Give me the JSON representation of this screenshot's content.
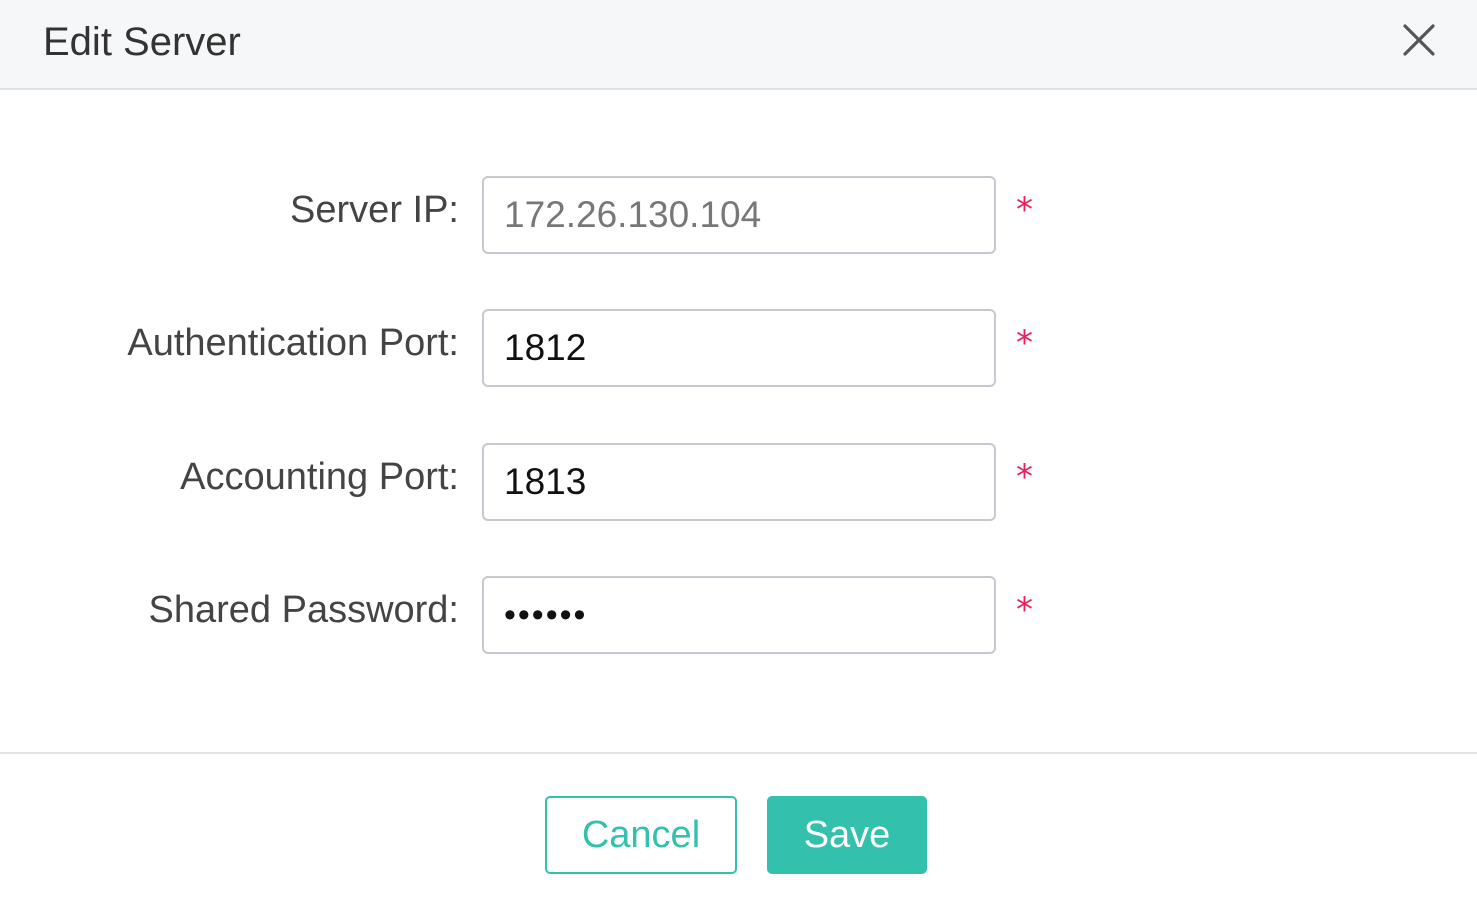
{
  "dialog": {
    "title": "Edit Server"
  },
  "form": {
    "fields": [
      {
        "label": "Server IP:",
        "value": "172.26.130.104",
        "required_mark": "*"
      },
      {
        "label": "Authentication Port:",
        "value": "1812",
        "required_mark": "*"
      },
      {
        "label": "Accounting Port:",
        "value": "1813",
        "required_mark": "*"
      },
      {
        "label": "Shared Password:",
        "value": "••••••",
        "required_mark": "*"
      }
    ]
  },
  "buttons": {
    "cancel_label": "Cancel",
    "save_label": "Save"
  },
  "colors": {
    "accent": "#33c1ad",
    "required": "#e8225b"
  },
  "icons": {
    "close": "close-icon"
  }
}
